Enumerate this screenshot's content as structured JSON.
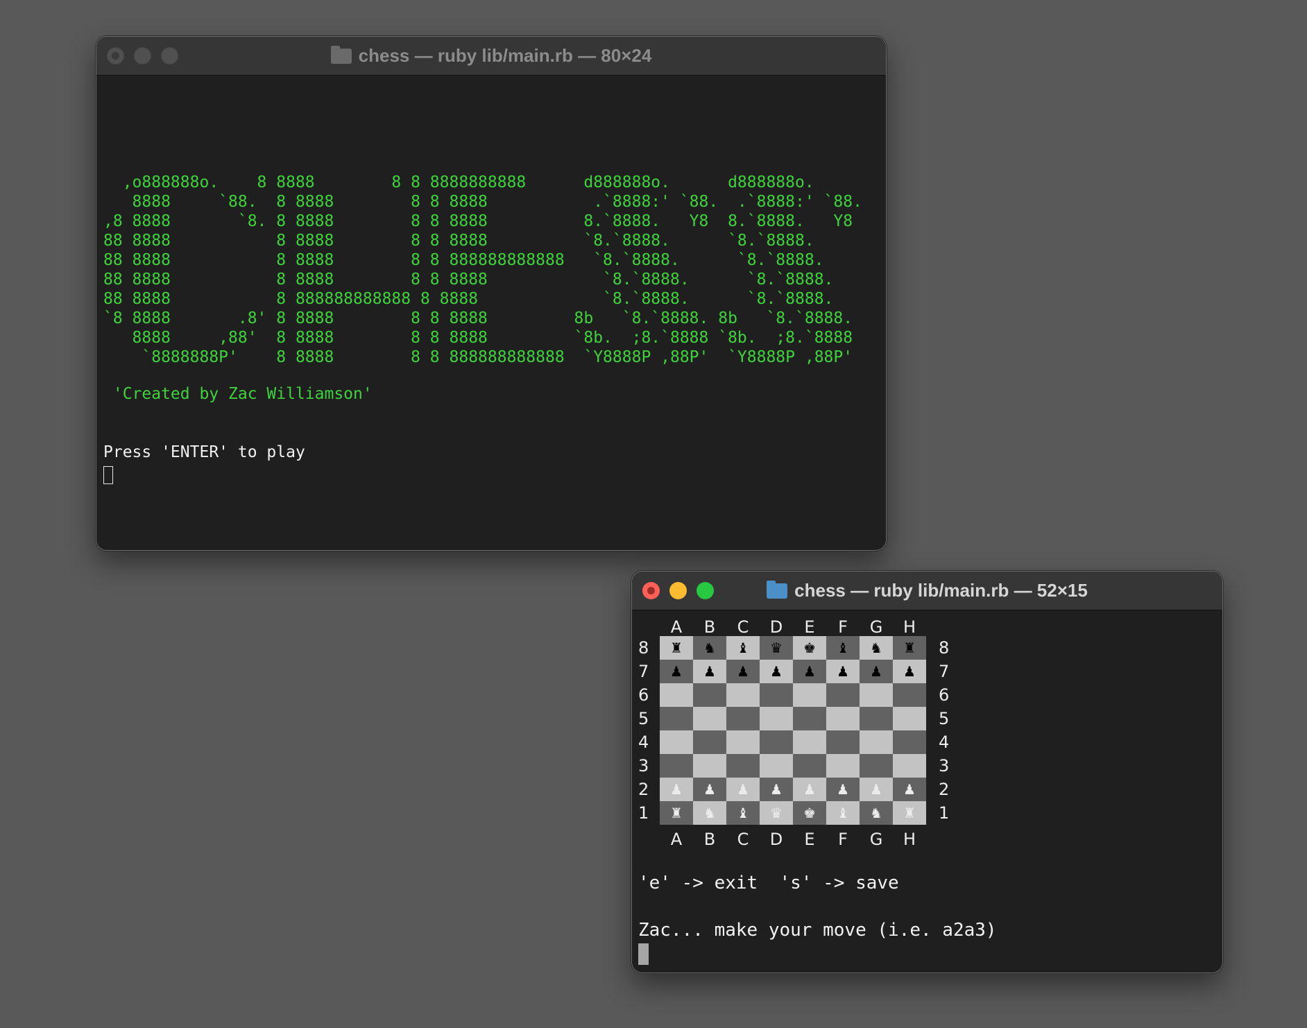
{
  "window1": {
    "title": "chess — ruby lib/main.rb — 80×24",
    "banner": [
      "  ,o888888o.    8 8888        8 8 8888888888      d888888o.      d888888o.",
      "   8888     `88.  8 8888        8 8 8888           .`8888:' `88.  .`8888:' `88.",
      ",8 8888       `8. 8 8888        8 8 8888          8.`8888.   Y8  8.`8888.   Y8",
      "88 8888           8 8888        8 8 8888          `8.`8888.      `8.`8888.",
      "88 8888           8 8888        8 8 888888888888   `8.`8888.      `8.`8888.",
      "88 8888           8 8888        8 8 8888            `8.`8888.      `8.`8888.",
      "88 8888           8 888888888888 8 8888             `8.`8888.      `8.`8888.",
      "`8 8888       .8' 8 8888        8 8 8888         8b   `8.`8888. 8b   `8.`8888.",
      "   8888     ,88'  8 8888        8 8 8888         `8b.  ;8.`8888 `8b.  ;8.`8888",
      "    `8888888P'    8 8888        8 8 888888888888  `Y8888P ,88P'  `Y8888P ,88P'"
    ],
    "credit": " 'Created by Zac Williamson'",
    "prompt": "Press 'ENTER' to play"
  },
  "window2": {
    "title": "chess — ruby lib/main.rb — 52×15",
    "files": [
      "A",
      "B",
      "C",
      "D",
      "E",
      "F",
      "G",
      "H"
    ],
    "ranks": [
      "8",
      "7",
      "6",
      "5",
      "4",
      "3",
      "2",
      "1"
    ],
    "board": [
      [
        "♜",
        "♞",
        "♝",
        "♛",
        "♚",
        "♝",
        "♞",
        "♜"
      ],
      [
        "♟",
        "♟",
        "♟",
        "♟",
        "♟",
        "♟",
        "♟",
        "♟"
      ],
      [
        "",
        "",
        "",
        "",
        "",
        "",
        "",
        ""
      ],
      [
        "",
        "",
        "",
        "",
        "",
        "",
        "",
        ""
      ],
      [
        "",
        "",
        "",
        "",
        "",
        "",
        "",
        ""
      ],
      [
        "",
        "",
        "",
        "",
        "",
        "",
        "",
        ""
      ],
      [
        "♟",
        "♟",
        "♟",
        "♟",
        "♟",
        "♟",
        "♟",
        "♟"
      ],
      [
        "♜",
        "♞",
        "♝",
        "♛",
        "♚",
        "♝",
        "♞",
        "♜"
      ]
    ],
    "controls": "'e' -> exit  's' -> save",
    "move_prompt": "Zac... make your move (i.e. a2a3)",
    "colors": {
      "light_square": "#c3c3c3",
      "dark_square": "#626262",
      "black_piece": "#000000",
      "white_piece": "#ececec"
    }
  }
}
